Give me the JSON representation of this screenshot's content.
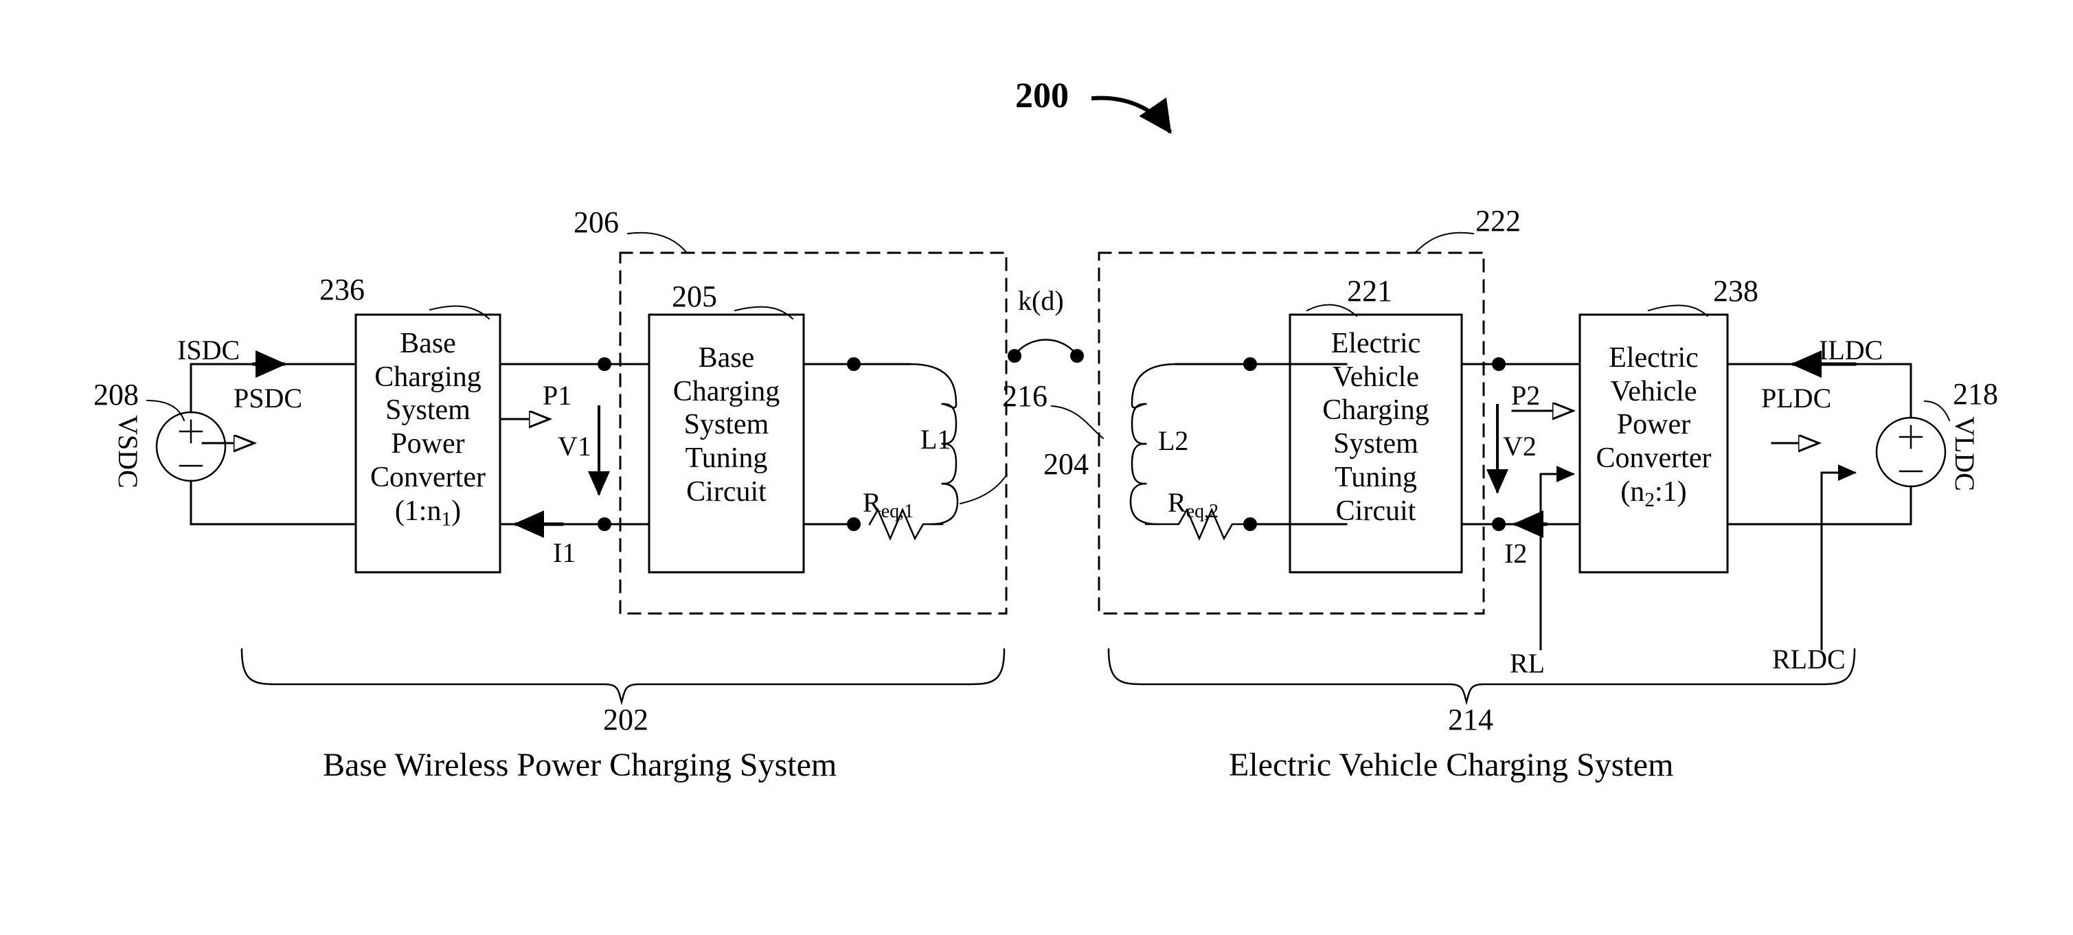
{
  "figure": {
    "number": "200",
    "type": "patent-block-diagram"
  },
  "reference_numerals": {
    "figure": "200",
    "source_base": "208",
    "base_system_brace": "202",
    "base_converter": "236",
    "base_tuning_circuit": "205",
    "base_tuning_box": "206",
    "base_coil": "204",
    "ev_coil": "216",
    "ev_tuning_circuit": "221",
    "ev_tuning_box": "222",
    "ev_converter": "238",
    "ev_system_brace": "214",
    "load_source": "218"
  },
  "blocks": {
    "base_power_converter": {
      "lines": [
        "Base",
        "Charging",
        "System",
        "Power",
        "Converter"
      ],
      "ratio_prefix": "(1:n",
      "ratio_sub": "1",
      "ratio_suffix": ")"
    },
    "base_tuning_circuit": {
      "lines": [
        "Base",
        "Charging",
        "System",
        "Tuning",
        "Circuit"
      ]
    },
    "ev_tuning_circuit": {
      "lines": [
        "Electric",
        "Vehicle",
        "Charging",
        "System",
        "Tuning",
        "Circuit"
      ]
    },
    "ev_power_converter": {
      "lines": [
        "Electric",
        "Vehicle",
        "Power",
        "Converter"
      ],
      "ratio_prefix": "(n",
      "ratio_sub": "2",
      "ratio_suffix": ":1)"
    }
  },
  "signals": {
    "isdc": "ISDC",
    "psdc": "PSDC",
    "vsdc": "VSDC",
    "p1": "P1",
    "v1": "V1",
    "i1": "I1",
    "l1": "L1",
    "req1_prefix": "R",
    "req1_sub": "eq,1",
    "coupling": "k(d)",
    "l2": "L2",
    "req2_prefix": "R",
    "req2_sub": "eq,2",
    "p2": "P2",
    "v2": "V2",
    "i2": "I2",
    "rl": "RL",
    "ildc": "ILDC",
    "pldc": "PLDC",
    "rldc": "RLDC",
    "vldc": "VLDC"
  },
  "captions": {
    "left": "Base Wireless Power Charging System",
    "right": "Electric Vehicle Charging System"
  },
  "colors": {
    "line": "#000000",
    "background": "#ffffff"
  }
}
